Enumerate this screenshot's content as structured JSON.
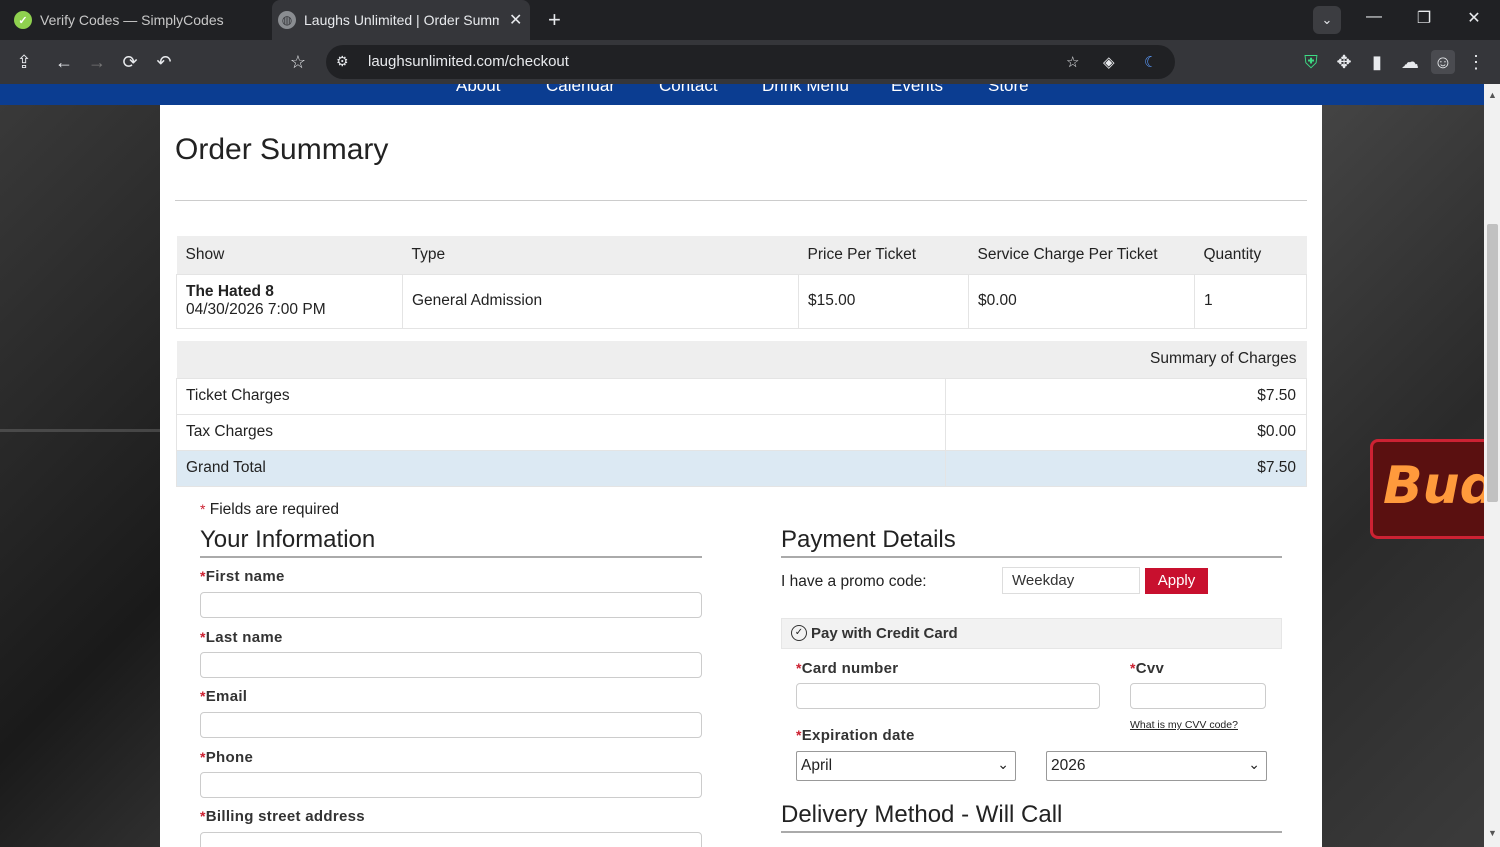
{
  "browser": {
    "tabs": [
      {
        "title": "Verify Codes — SimplyCodes",
        "favicon": "simplycodes-icon",
        "active": false
      },
      {
        "title": "Laughs Unlimited | Order Summary",
        "favicon": "globe-icon",
        "active": true
      }
    ],
    "close_glyph": "✕",
    "new_tab_glyph": "+",
    "url": "laughsunlimited.com/checkout"
  },
  "site": {
    "nav_items": [
      "About",
      "Calendar",
      "Contact",
      "Drink Menu",
      "Events",
      "Store"
    ],
    "neon_sign": "Bud",
    "nav_color": "#0b3d91"
  },
  "order": {
    "title": "Order Summary",
    "columns": [
      "Show",
      "Type",
      "Price Per Ticket",
      "Service Charge Per Ticket",
      "Quantity"
    ],
    "row": {
      "show": "The Hated 8",
      "datetime": "04/30/2026 7:00 PM",
      "type": "General Admission",
      "price": "$15.00",
      "service_charge": "$0.00",
      "quantity": "1"
    }
  },
  "charges": {
    "header": "Summary of Charges",
    "rows": [
      {
        "label": "Ticket Charges",
        "amount": "$7.50"
      },
      {
        "label": "Tax Charges",
        "amount": "$0.00"
      },
      {
        "label": "Grand Total",
        "amount": "$7.50"
      }
    ]
  },
  "form": {
    "required_star": "*",
    "required_note": "Fields are required",
    "your_info_title": "Your Information",
    "fields": {
      "first_name": "First name",
      "last_name": "Last name",
      "email": "Email",
      "phone": "Phone",
      "billing_address": "Billing street address"
    }
  },
  "payment": {
    "title": "Payment Details",
    "promo_label": "I have a promo code:",
    "promo_value": "Weekday",
    "apply_label": "Apply",
    "pay_option": "Pay with Credit Card",
    "card_number_label": "Card number",
    "cvv_label": "Cvv",
    "cvv_help": "What is my CVV code?",
    "expiration_label": "Expiration date",
    "exp_month": "April",
    "exp_year": "2026",
    "accent_color": "#c8102e"
  },
  "delivery": {
    "title": "Delivery Method - Will Call"
  }
}
